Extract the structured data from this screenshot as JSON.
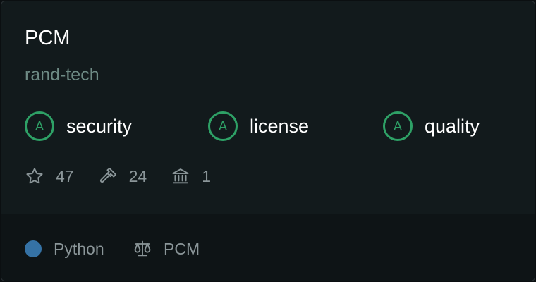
{
  "repo": {
    "name": "PCM",
    "owner": "rand-tech"
  },
  "grades": [
    {
      "grade": "A",
      "label": "security"
    },
    {
      "grade": "A",
      "label": "license"
    },
    {
      "grade": "A",
      "label": "quality"
    }
  ],
  "stats": {
    "stars": "47",
    "forks": "24",
    "dependents": "1",
    "icons": [
      "star-icon",
      "hammer-icon",
      "bank-icon"
    ]
  },
  "footer": {
    "language": "Python",
    "language_color": "#3572a5",
    "license": "PCM",
    "license_icon": "scale-icon"
  },
  "colors": {
    "grade_accent": "#2ea166"
  }
}
